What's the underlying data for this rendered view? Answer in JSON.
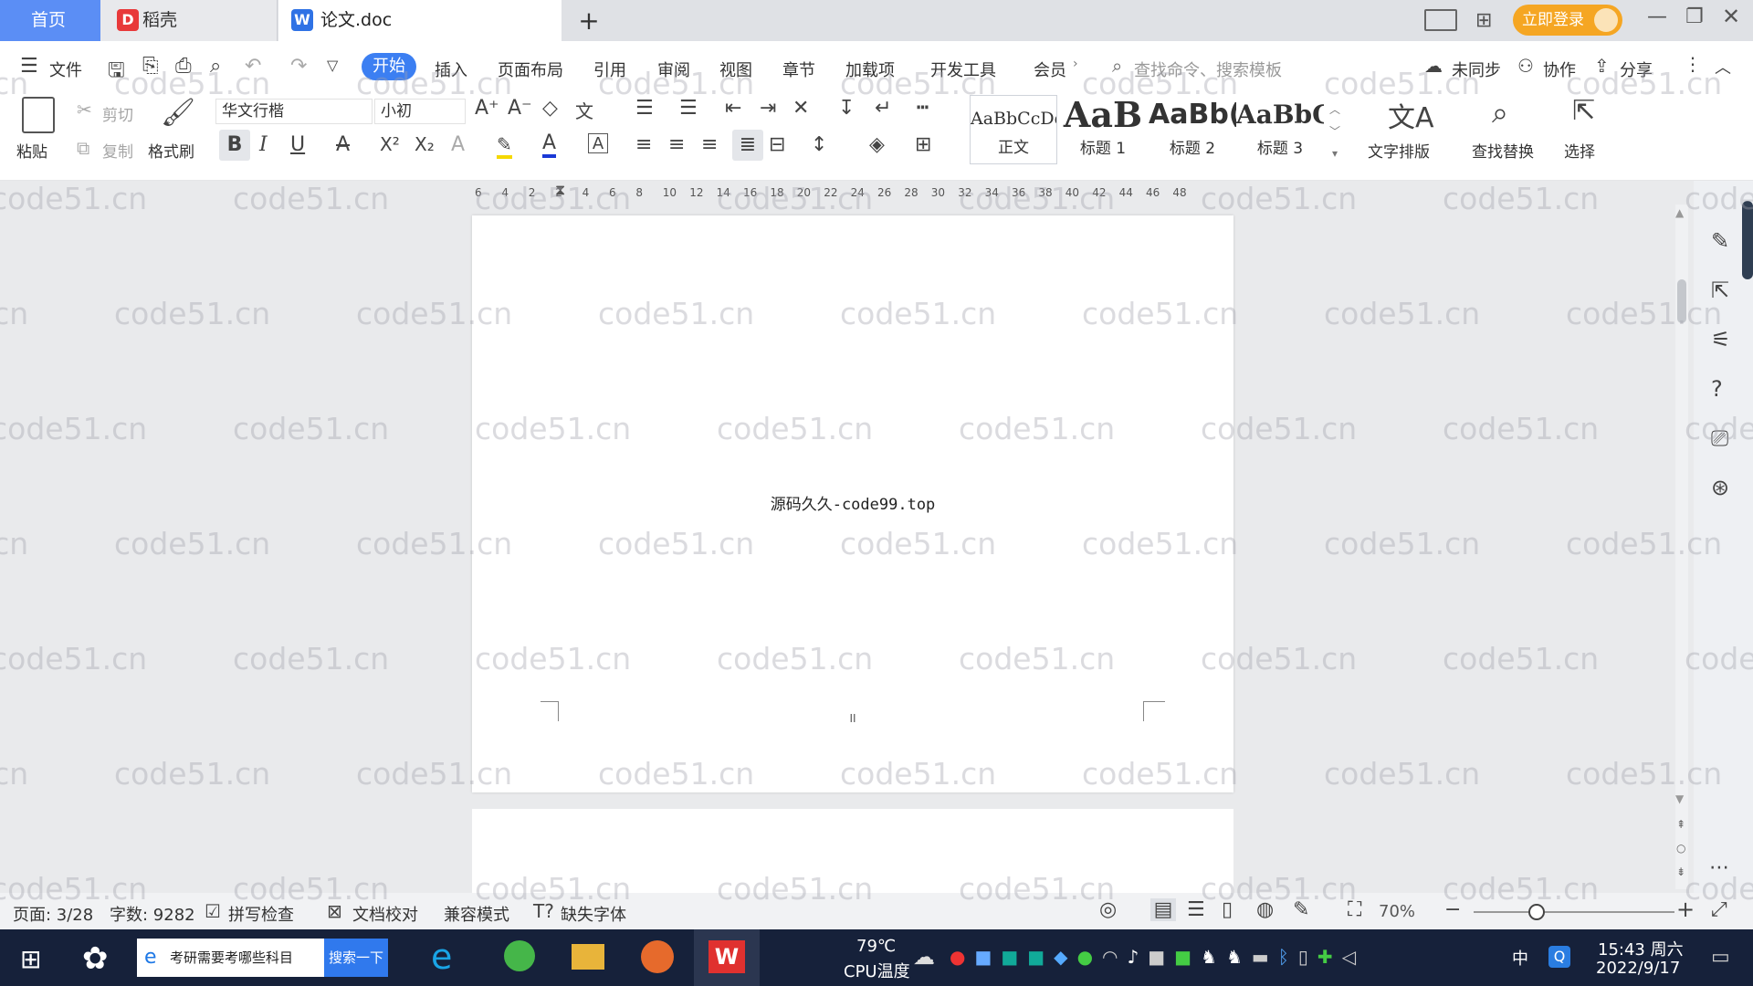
{
  "tabs": {
    "home": "首页",
    "shell": "稻壳",
    "doc": "论文.doc",
    "add": "+",
    "login": "立即登录"
  },
  "menu": {
    "file": "文件",
    "items": [
      "开始",
      "插入",
      "页面布局",
      "引用",
      "审阅",
      "视图",
      "章节",
      "加载项",
      "开发工具",
      "会员"
    ],
    "search_placeholder": "查找命令、搜索模板",
    "unsynced": "未同步",
    "collab": "协作",
    "share": "分享"
  },
  "ribbon": {
    "paste": "粘贴",
    "cut": "剪切",
    "copy": "复制",
    "format_painter": "格式刷",
    "font_name": "华文行楷",
    "font_size": "小初",
    "styles": [
      {
        "preview": "AaBbCcDd",
        "label": "正文"
      },
      {
        "preview": "AaB",
        "label": "标题 1"
      },
      {
        "preview": "AaBb(",
        "label": "标题 2"
      },
      {
        "preview": "AaBbC",
        "label": "标题 3"
      }
    ],
    "text_layout": "文字排版",
    "find_replace": "查找替换",
    "select": "选择"
  },
  "ruler_ticks": [
    "6",
    "4",
    "2",
    "2",
    "4",
    "6",
    "8",
    "10",
    "12",
    "14",
    "16",
    "18",
    "20",
    "22",
    "24",
    "26",
    "28",
    "30",
    "32",
    "34",
    "36",
    "38",
    "40",
    "42",
    "44",
    "46",
    "48"
  ],
  "document": {
    "line": "源码久久-code99.top",
    "page_number": "II"
  },
  "watermark": "code51.cn",
  "status": {
    "page": "页面: 3/28",
    "words": "字数: 9282",
    "spell": "拼写检查",
    "proofread": "文档校对",
    "compat": "兼容模式",
    "missing_font": "缺失字体",
    "zoom": "70%"
  },
  "taskbar": {
    "search_text": "考研需要考哪些科目",
    "search_btn": "搜索一下",
    "temp": "79℃",
    "cpu": "CPU温度",
    "ime": "中",
    "time": "15:43 周六",
    "date": "2022/9/17"
  },
  "colors": {
    "accent": "#3c7ff2",
    "home_tab": "#5b8ef5",
    "login": "#f5a623",
    "taskbar": "#16213a"
  }
}
